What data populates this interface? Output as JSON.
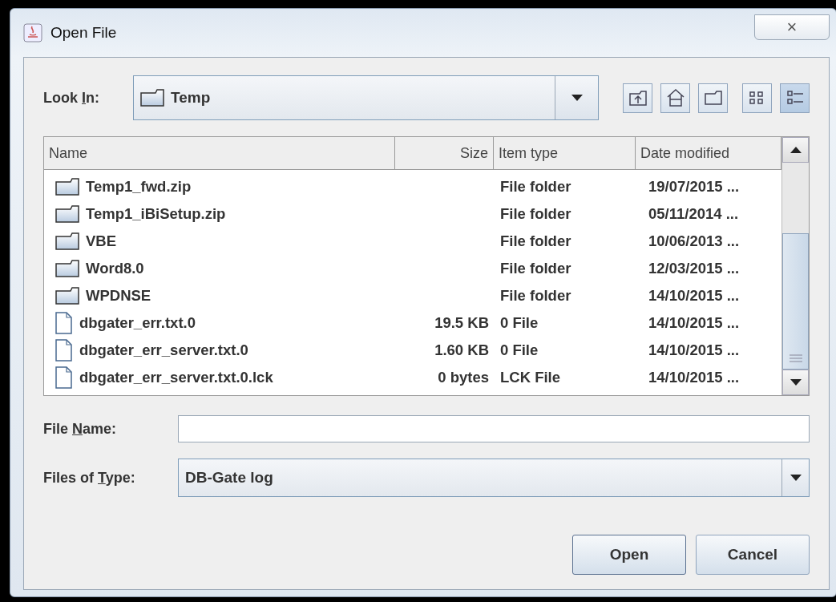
{
  "window": {
    "title": "Open File",
    "close": "×"
  },
  "look_in": {
    "label": {
      "before": "Look ",
      "key": "I",
      "after": "n:"
    },
    "value": "Temp"
  },
  "toolbar": [
    {
      "kind": "up",
      "selected": false
    },
    {
      "kind": "home",
      "selected": false
    },
    {
      "kind": "new-folder",
      "selected": false
    },
    {
      "kind": "list-view",
      "selected": false
    },
    {
      "kind": "details-view",
      "selected": true
    }
  ],
  "table": {
    "columns": [
      "Name",
      "Size",
      "Item type",
      "Date modified"
    ],
    "rows": [
      {
        "kind": "folder",
        "name": "Temp1_fwd.zip",
        "size": "",
        "type": "File folder",
        "date": "19/07/2015 ..."
      },
      {
        "kind": "folder",
        "name": "Temp1_iBiSetup.zip",
        "size": "",
        "type": "File folder",
        "date": "05/11/2014 ..."
      },
      {
        "kind": "folder",
        "name": "VBE",
        "size": "",
        "type": "File folder",
        "date": "10/06/2013 ..."
      },
      {
        "kind": "folder",
        "name": "Word8.0",
        "size": "",
        "type": "File folder",
        "date": "12/03/2015 ..."
      },
      {
        "kind": "folder",
        "name": "WPDNSE",
        "size": "",
        "type": "File folder",
        "date": "14/10/2015 ..."
      },
      {
        "kind": "file",
        "name": "dbgater_err.txt.0",
        "size": "19.5 KB",
        "type": "0 File",
        "date": "14/10/2015 ..."
      },
      {
        "kind": "file",
        "name": "dbgater_err_server.txt.0",
        "size": "1.60 KB",
        "type": "0 File",
        "date": "14/10/2015 ..."
      },
      {
        "kind": "file",
        "name": "dbgater_err_server.txt.0.lck",
        "size": "0 bytes",
        "type": "LCK File",
        "date": "14/10/2015 ..."
      }
    ]
  },
  "file_name": {
    "label": {
      "before": "File ",
      "key": "N",
      "after": "ame:"
    }
  },
  "files_of_type": {
    "label": {
      "before": "Files of ",
      "key": "T",
      "after": "ype:"
    },
    "value": "DB-Gate log"
  },
  "buttons": [
    "Open",
    "Cancel"
  ]
}
